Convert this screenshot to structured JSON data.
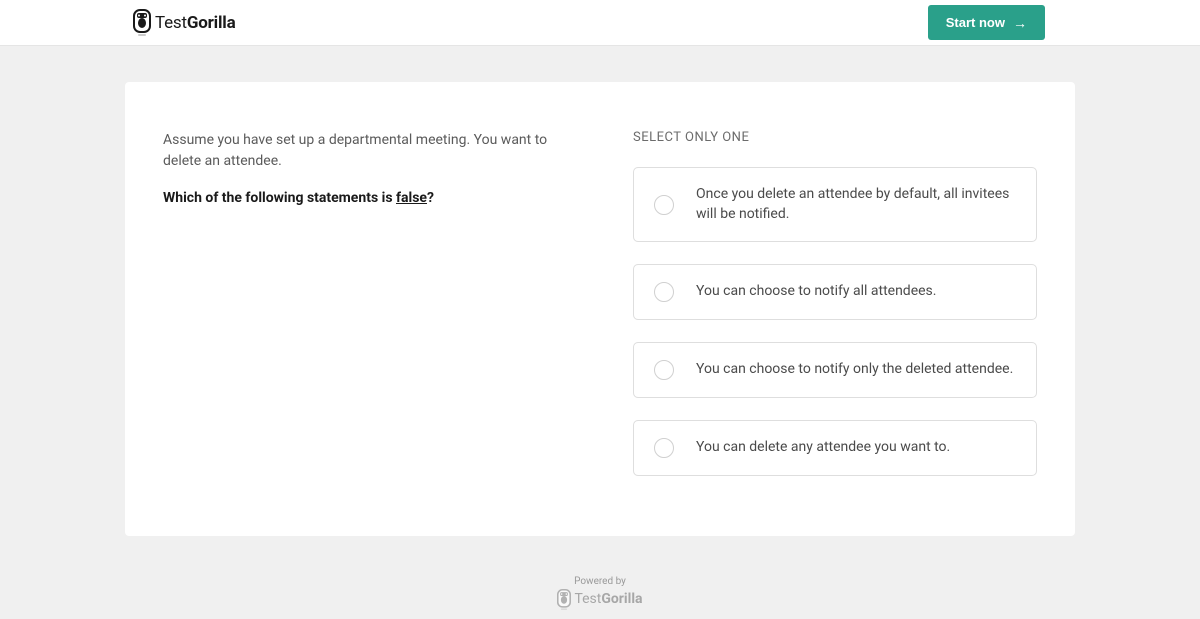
{
  "header": {
    "brand_prefix": "Test",
    "brand_suffix": "Gorilla",
    "start_button": "Start now"
  },
  "question": {
    "context": "Assume you have set up a departmental meeting. You want to delete an attendee.",
    "prompt_prefix": "Which of the following statements is ",
    "prompt_keyword": "false",
    "prompt_suffix": "?",
    "instruction": "SELECT ONLY ONE",
    "options": [
      "Once you delete an attendee by default, all invitees will be notified.",
      "You can choose to notify all attendees.",
      "You can choose to notify only the deleted attendee.",
      "You can delete any attendee you want to."
    ]
  },
  "footer": {
    "powered_by": "Powered by",
    "brand_prefix": "Test",
    "brand_suffix": "Gorilla"
  }
}
